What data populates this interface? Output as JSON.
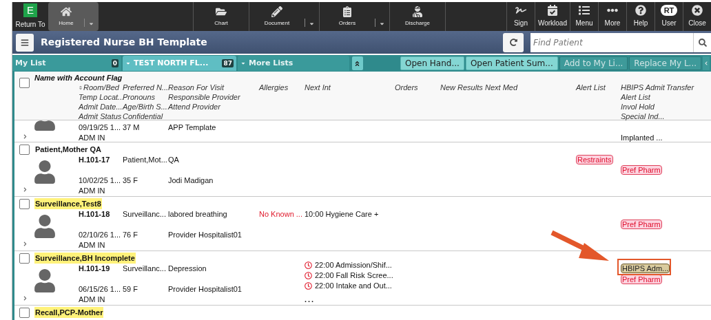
{
  "toolbar": {
    "left": [
      {
        "label": "Return To",
        "kind": "logo",
        "badge": "E",
        "selected": false,
        "dropdown": false
      },
      {
        "label": "Home",
        "kind": "tool",
        "selected": true,
        "dropdown": true
      }
    ],
    "center": [
      {
        "label": "Chart",
        "kind": "tool",
        "selected": false,
        "dropdown": false
      },
      {
        "label": "Document",
        "kind": "tool",
        "selected": false,
        "dropdown": true
      },
      {
        "label": "Orders",
        "kind": "tool",
        "selected": false,
        "dropdown": true
      },
      {
        "label": "Discharge",
        "kind": "tool",
        "selected": false,
        "dropdown": false
      }
    ],
    "right": [
      {
        "label": "Sign",
        "kind": "tool",
        "selected": false,
        "dropdown": false
      },
      {
        "label": "Workload",
        "kind": "tool",
        "selected": false,
        "dropdown": false
      },
      {
        "label": "Menu",
        "kind": "tool",
        "selected": false,
        "dropdown": false
      },
      {
        "label": "More",
        "kind": "tool",
        "selected": false,
        "dropdown": false
      },
      {
        "label": "Help",
        "kind": "tool",
        "selected": false,
        "dropdown": false
      },
      {
        "label": "User",
        "kind": "user",
        "badge": "RT",
        "selected": false,
        "dropdown": false
      },
      {
        "label": "Close",
        "kind": "tool",
        "selected": false,
        "dropdown": false
      }
    ]
  },
  "title_bar": {
    "title": "Registered Nurse BH Template",
    "search": {
      "placeholder": "Find Patient"
    }
  },
  "list_tabs": [
    {
      "label": "My List",
      "count": "0",
      "selected": false,
      "caret": false
    },
    {
      "label": "TEST NORTH FL...",
      "count": "87",
      "selected": true,
      "caret": true
    },
    {
      "label": "More Lists",
      "selected": false,
      "caret": true
    }
  ],
  "actions": [
    {
      "label": "Open Hand...",
      "disabled": false
    },
    {
      "label": "Open Patient Sum...",
      "disabled": false
    },
    {
      "label": "Add to My Li...",
      "disabled": true
    },
    {
      "label": "Replace My L...",
      "disabled": true
    }
  ],
  "table": {
    "name_header": "Name with Account Flag",
    "checked": false,
    "columns": [
      {
        "lines": [
          "Room/Bed",
          "Temp Locat...",
          "Admit Date...",
          "Admit Status"
        ],
        "sortable": true
      },
      {
        "lines": [
          "Preferred N...",
          "Pronouns",
          "Age/Birth S...",
          "Confidential"
        ],
        "sortable": false
      },
      {
        "lines": [
          "Reason For Visit",
          "Responsible Provider",
          "Attend Provider"
        ],
        "sortable": false
      },
      {
        "lines": [
          "Allergies"
        ],
        "sortable": false
      },
      {
        "lines": [
          "Next Int"
        ],
        "sortable": false
      },
      {
        "lines": [
          "Orders"
        ],
        "sortable": false
      },
      {
        "lines": [
          "New Results"
        ],
        "sortable": false
      },
      {
        "lines": [
          "Next Med"
        ],
        "sortable": false
      },
      {
        "lines": [
          "Alert List"
        ],
        "sortable": false
      },
      {
        "lines": [
          "HBIPS Admit",
          "Alert List",
          "Invol Hold",
          "Special Ind..."
        ],
        "sortable": false
      },
      {
        "lines": [
          "Transfer"
        ],
        "sortable": false
      }
    ],
    "rows": [
      {
        "kind": "clipped",
        "cells": [
          [
            null,
            null,
            "09/19/25 1...",
            "ADM IN"
          ],
          [
            null,
            null,
            "37 M",
            null
          ],
          [
            null,
            null,
            "APP Template",
            null
          ],
          null,
          null,
          null,
          null,
          null,
          null,
          [
            null,
            null,
            null,
            "Implanted ..."
          ],
          null
        ]
      },
      {
        "kind": "patient",
        "name": "Patient,Mother QA",
        "flagged": false,
        "checked": false,
        "cells": [
          [
            {
              "text": "H.101-17",
              "kind": "room"
            },
            null,
            "10/02/25 1...",
            "ADM IN"
          ],
          [
            "Patient,Mot...",
            null,
            "35 F",
            null
          ],
          [
            "QA",
            null,
            "Jodi Madigan",
            null
          ],
          null,
          null,
          null,
          null,
          null,
          [
            {
              "text": "Restraints",
              "kind": "alert"
            }
          ],
          [
            null,
            {
              "text": "Pref Pharm",
              "kind": "alert"
            },
            null,
            null
          ],
          null
        ]
      },
      {
        "kind": "patient",
        "name": "Surveillance,Test8",
        "flagged": true,
        "checked": false,
        "cells": [
          [
            {
              "text": "H.101-18",
              "kind": "room"
            },
            null,
            "02/10/26 1...",
            "ADM IN"
          ],
          [
            "Surveillanc...",
            null,
            "76 F",
            null
          ],
          [
            "labored breathing",
            null,
            "Provider Hospitalist01",
            null
          ],
          [
            {
              "text": "No Known ...",
              "kind": "warning"
            }
          ],
          [
            "10:00 Hygiene Care +"
          ],
          null,
          null,
          null,
          null,
          [
            null,
            {
              "text": "Pref Pharm",
              "kind": "alert"
            },
            null,
            null
          ],
          null
        ]
      },
      {
        "kind": "patient",
        "name": "Surveillance,BH Incomplete",
        "flagged": true,
        "checked": false,
        "cells": [
          [
            {
              "text": "H.101-19",
              "kind": "room"
            },
            null,
            "06/15/26 1...",
            "ADM IN"
          ],
          [
            "Surveillanc...",
            null,
            "59 F",
            null
          ],
          [
            "Depression",
            null,
            "Provider Hospitalist01",
            null
          ],
          null,
          [
            {
              "text": "22:00 Admission/Shif...",
              "kind": "task"
            },
            {
              "text": "22:00 Fall Risk Scree...",
              "kind": "task"
            },
            {
              "text": "22:00 Intake and Out...",
              "kind": "task"
            },
            {
              "text": "...",
              "kind": "more"
            }
          ],
          null,
          null,
          null,
          null,
          [
            {
              "text": "HBIPS Adm...",
              "kind": "status",
              "highlighted": true
            },
            {
              "text": "Pref Pharm",
              "kind": "alert"
            },
            null,
            null
          ],
          null
        ]
      },
      {
        "kind": "patient",
        "name": "Recall,PCP-Mother",
        "flagged": true,
        "checked": false,
        "cells": []
      }
    ]
  },
  "annotation": {
    "kind": "arrow"
  }
}
